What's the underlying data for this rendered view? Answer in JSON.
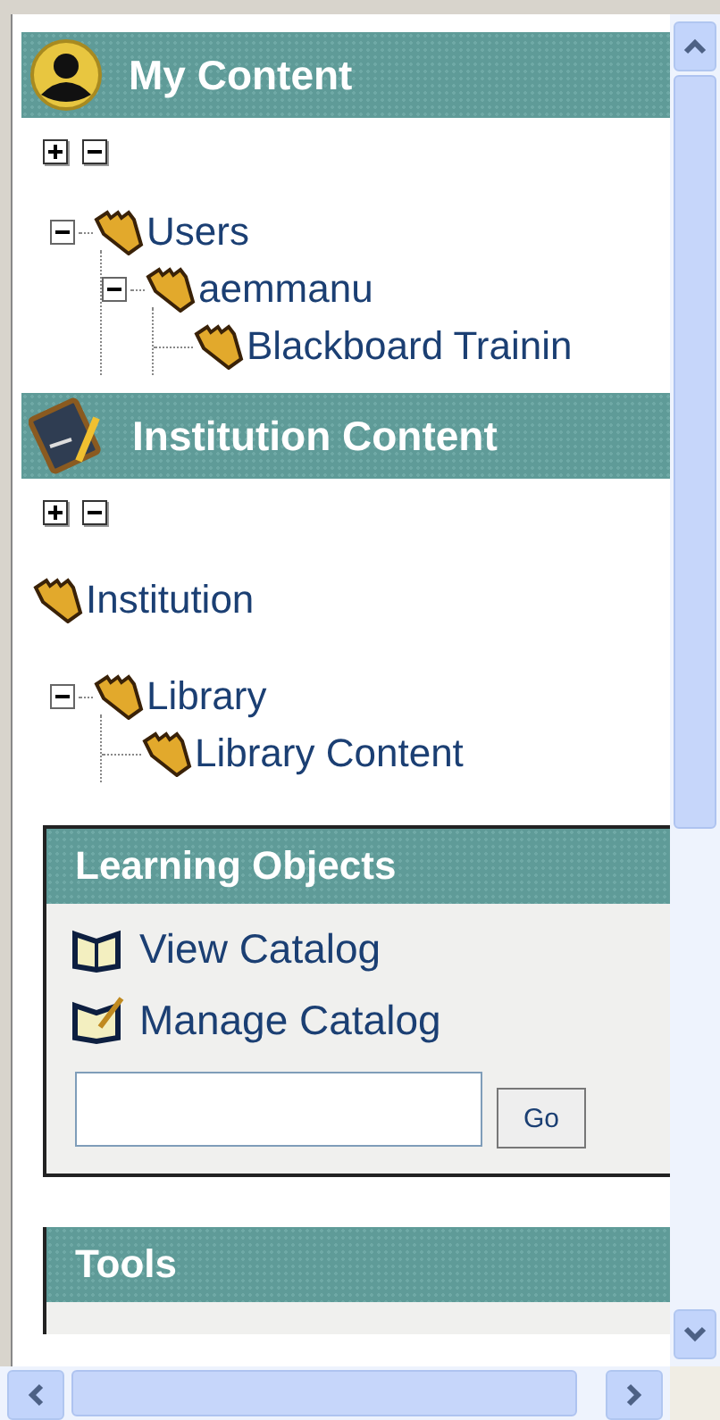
{
  "sections": [
    {
      "kind": "user",
      "title": "My Content",
      "tree": [
        {
          "label": "Users",
          "expanded": true,
          "children": [
            {
              "label": "aemmanu",
              "expanded": true,
              "children": [
                {
                  "label": "Blackboard Trainin"
                }
              ]
            }
          ]
        }
      ]
    },
    {
      "kind": "board",
      "title": "Institution Content",
      "root": "Institution",
      "tree": [
        {
          "label": "Library",
          "expanded": true,
          "children": [
            {
              "label": "Library Content"
            }
          ]
        }
      ]
    }
  ],
  "learning_objects": {
    "title": "Learning Objects",
    "links": [
      {
        "kind": "view",
        "label": "View Catalog"
      },
      {
        "kind": "manage",
        "label": "Manage Catalog"
      }
    ],
    "button": "Go"
  },
  "tools": {
    "title": "Tools"
  }
}
